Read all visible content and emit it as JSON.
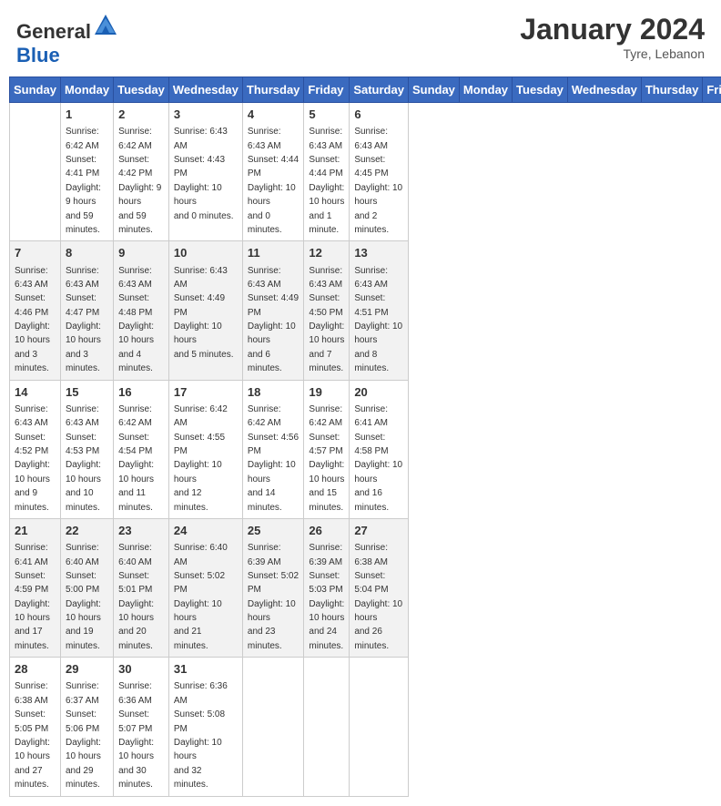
{
  "header": {
    "logo_general": "General",
    "logo_blue": "Blue",
    "month_year": "January 2024",
    "location": "Tyre, Lebanon"
  },
  "days_of_week": [
    "Sunday",
    "Monday",
    "Tuesday",
    "Wednesday",
    "Thursday",
    "Friday",
    "Saturday"
  ],
  "weeks": [
    [
      {
        "day": "",
        "info": ""
      },
      {
        "day": "1",
        "info": "Sunrise: 6:42 AM\nSunset: 4:41 PM\nDaylight: 9 hours\nand 59 minutes."
      },
      {
        "day": "2",
        "info": "Sunrise: 6:42 AM\nSunset: 4:42 PM\nDaylight: 9 hours\nand 59 minutes."
      },
      {
        "day": "3",
        "info": "Sunrise: 6:43 AM\nSunset: 4:43 PM\nDaylight: 10 hours\nand 0 minutes."
      },
      {
        "day": "4",
        "info": "Sunrise: 6:43 AM\nSunset: 4:44 PM\nDaylight: 10 hours\nand 0 minutes."
      },
      {
        "day": "5",
        "info": "Sunrise: 6:43 AM\nSunset: 4:44 PM\nDaylight: 10 hours\nand 1 minute."
      },
      {
        "day": "6",
        "info": "Sunrise: 6:43 AM\nSunset: 4:45 PM\nDaylight: 10 hours\nand 2 minutes."
      }
    ],
    [
      {
        "day": "7",
        "info": "Sunrise: 6:43 AM\nSunset: 4:46 PM\nDaylight: 10 hours\nand 3 minutes."
      },
      {
        "day": "8",
        "info": "Sunrise: 6:43 AM\nSunset: 4:47 PM\nDaylight: 10 hours\nand 3 minutes."
      },
      {
        "day": "9",
        "info": "Sunrise: 6:43 AM\nSunset: 4:48 PM\nDaylight: 10 hours\nand 4 minutes."
      },
      {
        "day": "10",
        "info": "Sunrise: 6:43 AM\nSunset: 4:49 PM\nDaylight: 10 hours\nand 5 minutes."
      },
      {
        "day": "11",
        "info": "Sunrise: 6:43 AM\nSunset: 4:49 PM\nDaylight: 10 hours\nand 6 minutes."
      },
      {
        "day": "12",
        "info": "Sunrise: 6:43 AM\nSunset: 4:50 PM\nDaylight: 10 hours\nand 7 minutes."
      },
      {
        "day": "13",
        "info": "Sunrise: 6:43 AM\nSunset: 4:51 PM\nDaylight: 10 hours\nand 8 minutes."
      }
    ],
    [
      {
        "day": "14",
        "info": "Sunrise: 6:43 AM\nSunset: 4:52 PM\nDaylight: 10 hours\nand 9 minutes."
      },
      {
        "day": "15",
        "info": "Sunrise: 6:43 AM\nSunset: 4:53 PM\nDaylight: 10 hours\nand 10 minutes."
      },
      {
        "day": "16",
        "info": "Sunrise: 6:42 AM\nSunset: 4:54 PM\nDaylight: 10 hours\nand 11 minutes."
      },
      {
        "day": "17",
        "info": "Sunrise: 6:42 AM\nSunset: 4:55 PM\nDaylight: 10 hours\nand 12 minutes."
      },
      {
        "day": "18",
        "info": "Sunrise: 6:42 AM\nSunset: 4:56 PM\nDaylight: 10 hours\nand 14 minutes."
      },
      {
        "day": "19",
        "info": "Sunrise: 6:42 AM\nSunset: 4:57 PM\nDaylight: 10 hours\nand 15 minutes."
      },
      {
        "day": "20",
        "info": "Sunrise: 6:41 AM\nSunset: 4:58 PM\nDaylight: 10 hours\nand 16 minutes."
      }
    ],
    [
      {
        "day": "21",
        "info": "Sunrise: 6:41 AM\nSunset: 4:59 PM\nDaylight: 10 hours\nand 17 minutes."
      },
      {
        "day": "22",
        "info": "Sunrise: 6:40 AM\nSunset: 5:00 PM\nDaylight: 10 hours\nand 19 minutes."
      },
      {
        "day": "23",
        "info": "Sunrise: 6:40 AM\nSunset: 5:01 PM\nDaylight: 10 hours\nand 20 minutes."
      },
      {
        "day": "24",
        "info": "Sunrise: 6:40 AM\nSunset: 5:02 PM\nDaylight: 10 hours\nand 21 minutes."
      },
      {
        "day": "25",
        "info": "Sunrise: 6:39 AM\nSunset: 5:02 PM\nDaylight: 10 hours\nand 23 minutes."
      },
      {
        "day": "26",
        "info": "Sunrise: 6:39 AM\nSunset: 5:03 PM\nDaylight: 10 hours\nand 24 minutes."
      },
      {
        "day": "27",
        "info": "Sunrise: 6:38 AM\nSunset: 5:04 PM\nDaylight: 10 hours\nand 26 minutes."
      }
    ],
    [
      {
        "day": "28",
        "info": "Sunrise: 6:38 AM\nSunset: 5:05 PM\nDaylight: 10 hours\nand 27 minutes."
      },
      {
        "day": "29",
        "info": "Sunrise: 6:37 AM\nSunset: 5:06 PM\nDaylight: 10 hours\nand 29 minutes."
      },
      {
        "day": "30",
        "info": "Sunrise: 6:36 AM\nSunset: 5:07 PM\nDaylight: 10 hours\nand 30 minutes."
      },
      {
        "day": "31",
        "info": "Sunrise: 6:36 AM\nSunset: 5:08 PM\nDaylight: 10 hours\nand 32 minutes."
      },
      {
        "day": "",
        "info": ""
      },
      {
        "day": "",
        "info": ""
      },
      {
        "day": "",
        "info": ""
      }
    ]
  ]
}
